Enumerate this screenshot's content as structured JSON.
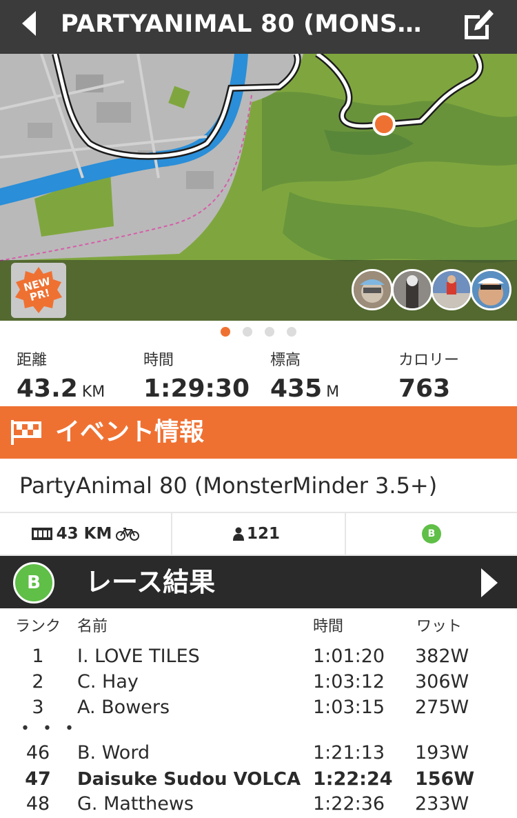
{
  "header": {
    "title": "PARTYANIMAL 80 (MONS…"
  },
  "map": {
    "badge_text": "NEW\nPR!",
    "badge_line1": "NEW",
    "badge_line2": "PR!",
    "colors": {
      "urban": "#b9b9b9",
      "grass": "#7fa63e",
      "river": "#2a8ed8",
      "route": "#ffffff",
      "marker": "#ef7132"
    }
  },
  "pager": {
    "count": 4,
    "active_index": 0
  },
  "stats": [
    {
      "label": "距離",
      "value": "43.2",
      "unit": "KM"
    },
    {
      "label": "時間",
      "value": "1:29:30",
      "unit": ""
    },
    {
      "label": "標高",
      "value": "435",
      "unit": "M"
    },
    {
      "label": "カロリー",
      "value": "763",
      "unit": ""
    }
  ],
  "event": {
    "banner_label": "イベント情報",
    "name": "PartyAnimal 80 (MonsterMinder 3.5+)",
    "distance": "43 KM",
    "participants": "121",
    "category": "B"
  },
  "results": {
    "category": "B",
    "title": "レース結果",
    "headers": {
      "rank": "ランク",
      "name": "名前",
      "time": "時間",
      "watt": "ワット"
    },
    "ellipsis": "• • •",
    "rows_top": [
      {
        "rank": "1",
        "name": "I. LOVE TILES",
        "time": "1:01:20",
        "watt": "382W"
      },
      {
        "rank": "2",
        "name": "C. Hay",
        "time": "1:03:12",
        "watt": "306W"
      },
      {
        "rank": "3",
        "name": "A. Bowers",
        "time": "1:03:15",
        "watt": "275W"
      }
    ],
    "rows_bottom": [
      {
        "rank": "46",
        "name": "B. Word",
        "time": "1:21:13",
        "watt": "193W"
      },
      {
        "rank": "47",
        "name": "Daisuke Sudou VOLCA",
        "time": "1:22:24",
        "watt": "156W"
      },
      {
        "rank": "48",
        "name": "G. Matthews",
        "time": "1:22:36",
        "watt": "233W"
      }
    ]
  },
  "colors": {
    "accent": "#ef7132",
    "header_bg": "#3b3b3b",
    "results_bg": "#2a2a2a",
    "category_b": "#5fbf47"
  }
}
